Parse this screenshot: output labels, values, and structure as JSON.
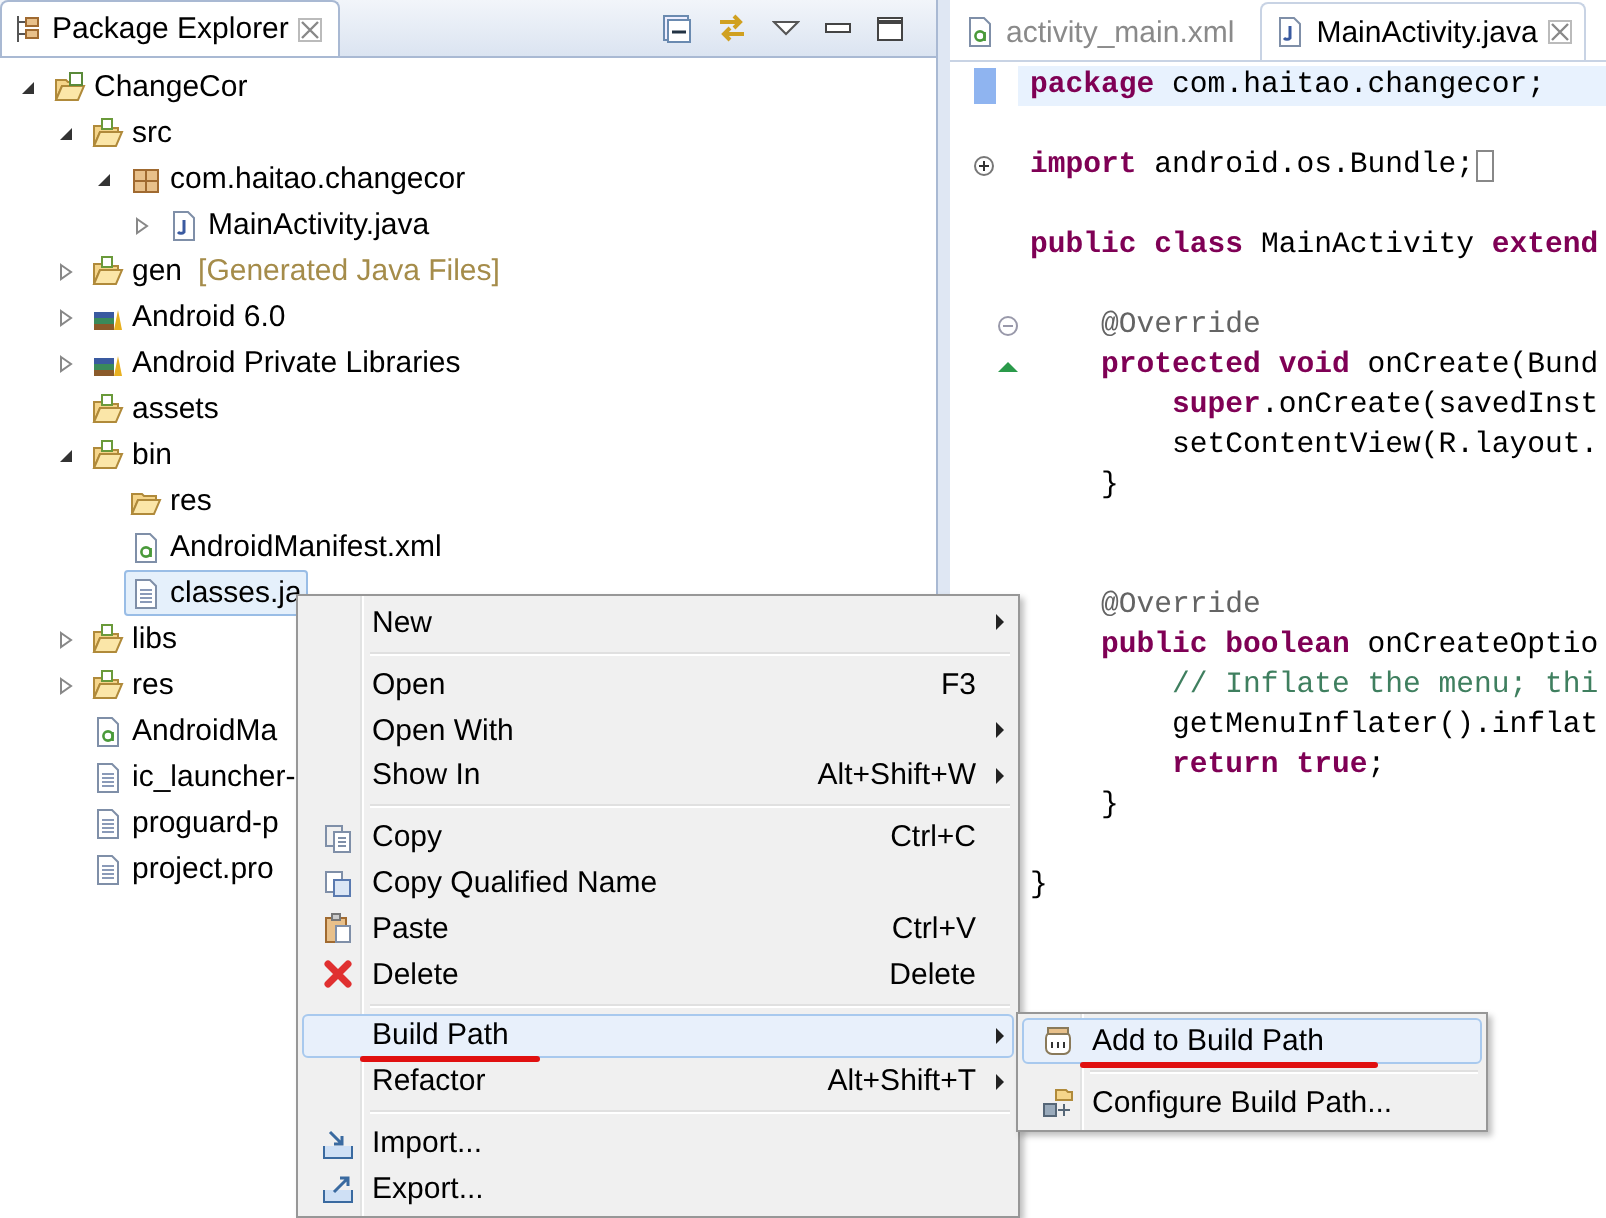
{
  "package_explorer": {
    "title": "Package Explorer",
    "tree": [
      {
        "label": "ChangeCor",
        "kind": "project",
        "expanded": true,
        "selected": false,
        "children": [
          {
            "label": "src",
            "kind": "source-folder",
            "expanded": true,
            "selected": false,
            "children": [
              {
                "label": "com.haitao.changecor",
                "kind": "package",
                "expanded": true,
                "selected": false,
                "children": [
                  {
                    "label": "MainActivity.java",
                    "kind": "java-file",
                    "expanded": false,
                    "selected": false
                  }
                ]
              }
            ]
          },
          {
            "label": "gen",
            "decoration": "[Generated Java Files]",
            "kind": "source-folder",
            "expanded": false,
            "selected": false
          },
          {
            "label": "Android 6.0",
            "kind": "library",
            "expanded": false,
            "selected": false
          },
          {
            "label": "Android Private Libraries",
            "kind": "library",
            "expanded": false,
            "selected": false
          },
          {
            "label": "assets",
            "kind": "source-folder",
            "selected": false
          },
          {
            "label": "bin",
            "kind": "source-folder",
            "expanded": true,
            "selected": false,
            "children": [
              {
                "label": "res",
                "kind": "folder",
                "selected": false
              },
              {
                "label": "AndroidManifest.xml",
                "kind": "xml-file",
                "selected": false
              },
              {
                "label": "classes.ja",
                "kind": "text-file",
                "selected": true
              }
            ]
          },
          {
            "label": "libs",
            "kind": "source-folder",
            "expanded": false,
            "selected": false
          },
          {
            "label": "res",
            "kind": "source-folder",
            "expanded": false,
            "selected": false
          },
          {
            "label": "AndroidMa",
            "kind": "xml-file",
            "selected": false
          },
          {
            "label": "ic_launcher-",
            "kind": "text-file",
            "selected": false
          },
          {
            "label": "proguard-p",
            "kind": "text-file",
            "selected": false
          },
          {
            "label": "project.pro",
            "kind": "text-file",
            "selected": false
          }
        ]
      }
    ]
  },
  "editor": {
    "tabs": [
      {
        "label": "activity_main.xml",
        "kind": "xml-file",
        "selected": false
      },
      {
        "label": "MainActivity.java",
        "kind": "java-file",
        "selected": true
      }
    ],
    "lines": [
      {
        "kind": "occurrence",
        "current": true,
        "tokens": [
          {
            "kind": "keyword",
            "text": "package"
          },
          {
            "kind": "plain",
            "text": " com.haitao.changecor;"
          }
        ]
      },
      {
        "kind": "blank"
      },
      {
        "kind": "fold-expand",
        "current": false,
        "tokens": [
          {
            "kind": "keyword",
            "text": "import"
          },
          {
            "kind": "plain",
            "text": " android.os.Bundle;"
          }
        ]
      },
      {
        "kind": "blank"
      },
      {
        "kind": "plain",
        "current": false,
        "tokens": [
          {
            "kind": "keyword",
            "text": "public class"
          },
          {
            "kind": "plain",
            "text": " MainActivity "
          },
          {
            "kind": "keyword",
            "text": "extend"
          }
        ]
      },
      {
        "kind": "blank"
      },
      {
        "kind": "fold-collapse",
        "current": false,
        "tokens": [
          {
            "kind": "annotation",
            "text": "    @Override"
          }
        ]
      },
      {
        "kind": "override",
        "current": false,
        "tokens": [
          {
            "kind": "keyword",
            "text": "    protected void"
          },
          {
            "kind": "plain",
            "text": " onCreate(Bund"
          }
        ]
      },
      {
        "kind": "plain",
        "current": false,
        "tokens": [
          {
            "kind": "keyword",
            "text": "        super"
          },
          {
            "kind": "plain",
            "text": ".onCreate(savedInst"
          }
        ]
      },
      {
        "kind": "plain",
        "current": false,
        "tokens": [
          {
            "kind": "plain",
            "text": "        setContentView(R.layout."
          }
        ]
      },
      {
        "kind": "plain",
        "current": false,
        "tokens": [
          {
            "kind": "plain",
            "text": "    }"
          }
        ]
      },
      {
        "kind": "blank"
      },
      {
        "kind": "blank"
      },
      {
        "kind": "plain",
        "current": false,
        "tokens": [
          {
            "kind": "annotation",
            "text": "    @Override"
          }
        ]
      },
      {
        "kind": "plain",
        "current": false,
        "tokens": [
          {
            "kind": "keyword",
            "text": "    public boolean"
          },
          {
            "kind": "plain",
            "text": " onCreateOptio"
          }
        ]
      },
      {
        "kind": "plain",
        "current": false,
        "tokens": [
          {
            "kind": "comment",
            "text": "        // Inflate the menu; thi"
          }
        ]
      },
      {
        "kind": "plain",
        "current": false,
        "tokens": [
          {
            "kind": "plain",
            "text": "        getMenuInflater().inflat"
          }
        ]
      },
      {
        "kind": "plain",
        "current": false,
        "tokens": [
          {
            "kind": "keyword",
            "text": "        return true"
          },
          {
            "kind": "plain",
            "text": ";"
          }
        ]
      },
      {
        "kind": "plain",
        "current": false,
        "tokens": [
          {
            "kind": "plain",
            "text": "    }"
          }
        ]
      },
      {
        "kind": "blank"
      },
      {
        "kind": "plain",
        "current": false,
        "tokens": [
          {
            "kind": "plain",
            "text": "}"
          }
        ]
      }
    ]
  },
  "context_menu": {
    "groups": [
      [
        {
          "label": "New",
          "submenu": true,
          "selected": false,
          "marked": false
        }
      ],
      [
        {
          "label": "Open",
          "shortcut": "F3",
          "submenu": false,
          "selected": false,
          "marked": false
        },
        {
          "label": "Open With",
          "submenu": true,
          "selected": false,
          "marked": false
        },
        {
          "label": "Show In",
          "shortcut": "Alt+Shift+W",
          "submenu": true,
          "selected": false,
          "marked": false
        }
      ],
      [
        {
          "label": "Copy",
          "kind": "copy",
          "shortcut": "Ctrl+C",
          "submenu": false,
          "selected": false,
          "marked": false
        },
        {
          "label": "Copy Qualified Name",
          "kind": "copy-name",
          "submenu": false,
          "selected": false,
          "marked": false
        },
        {
          "label": "Paste",
          "kind": "paste",
          "shortcut": "Ctrl+V",
          "submenu": false,
          "selected": false,
          "marked": false
        },
        {
          "label": "Delete",
          "kind": "delete",
          "shortcut": "Delete",
          "submenu": false,
          "selected": false,
          "marked": false
        }
      ],
      [
        {
          "label": "Build Path",
          "submenu": true,
          "selected": true,
          "marked": true
        },
        {
          "label": "Refactor",
          "shortcut": "Alt+Shift+T",
          "submenu": true,
          "selected": false,
          "marked": false
        }
      ],
      [
        {
          "label": "Import...",
          "kind": "import",
          "submenu": false,
          "selected": false,
          "marked": false
        },
        {
          "label": "Export...",
          "kind": "export",
          "submenu": false,
          "selected": false,
          "marked": false
        }
      ]
    ]
  },
  "submenu": {
    "groups": [
      [
        {
          "label": "Add to Build Path",
          "kind": "jar",
          "submenu": false,
          "selected": true,
          "marked": true
        }
      ],
      [
        {
          "label": "Configure Build Path...",
          "kind": "configure",
          "submenu": false,
          "selected": false,
          "marked": false
        }
      ]
    ]
  }
}
